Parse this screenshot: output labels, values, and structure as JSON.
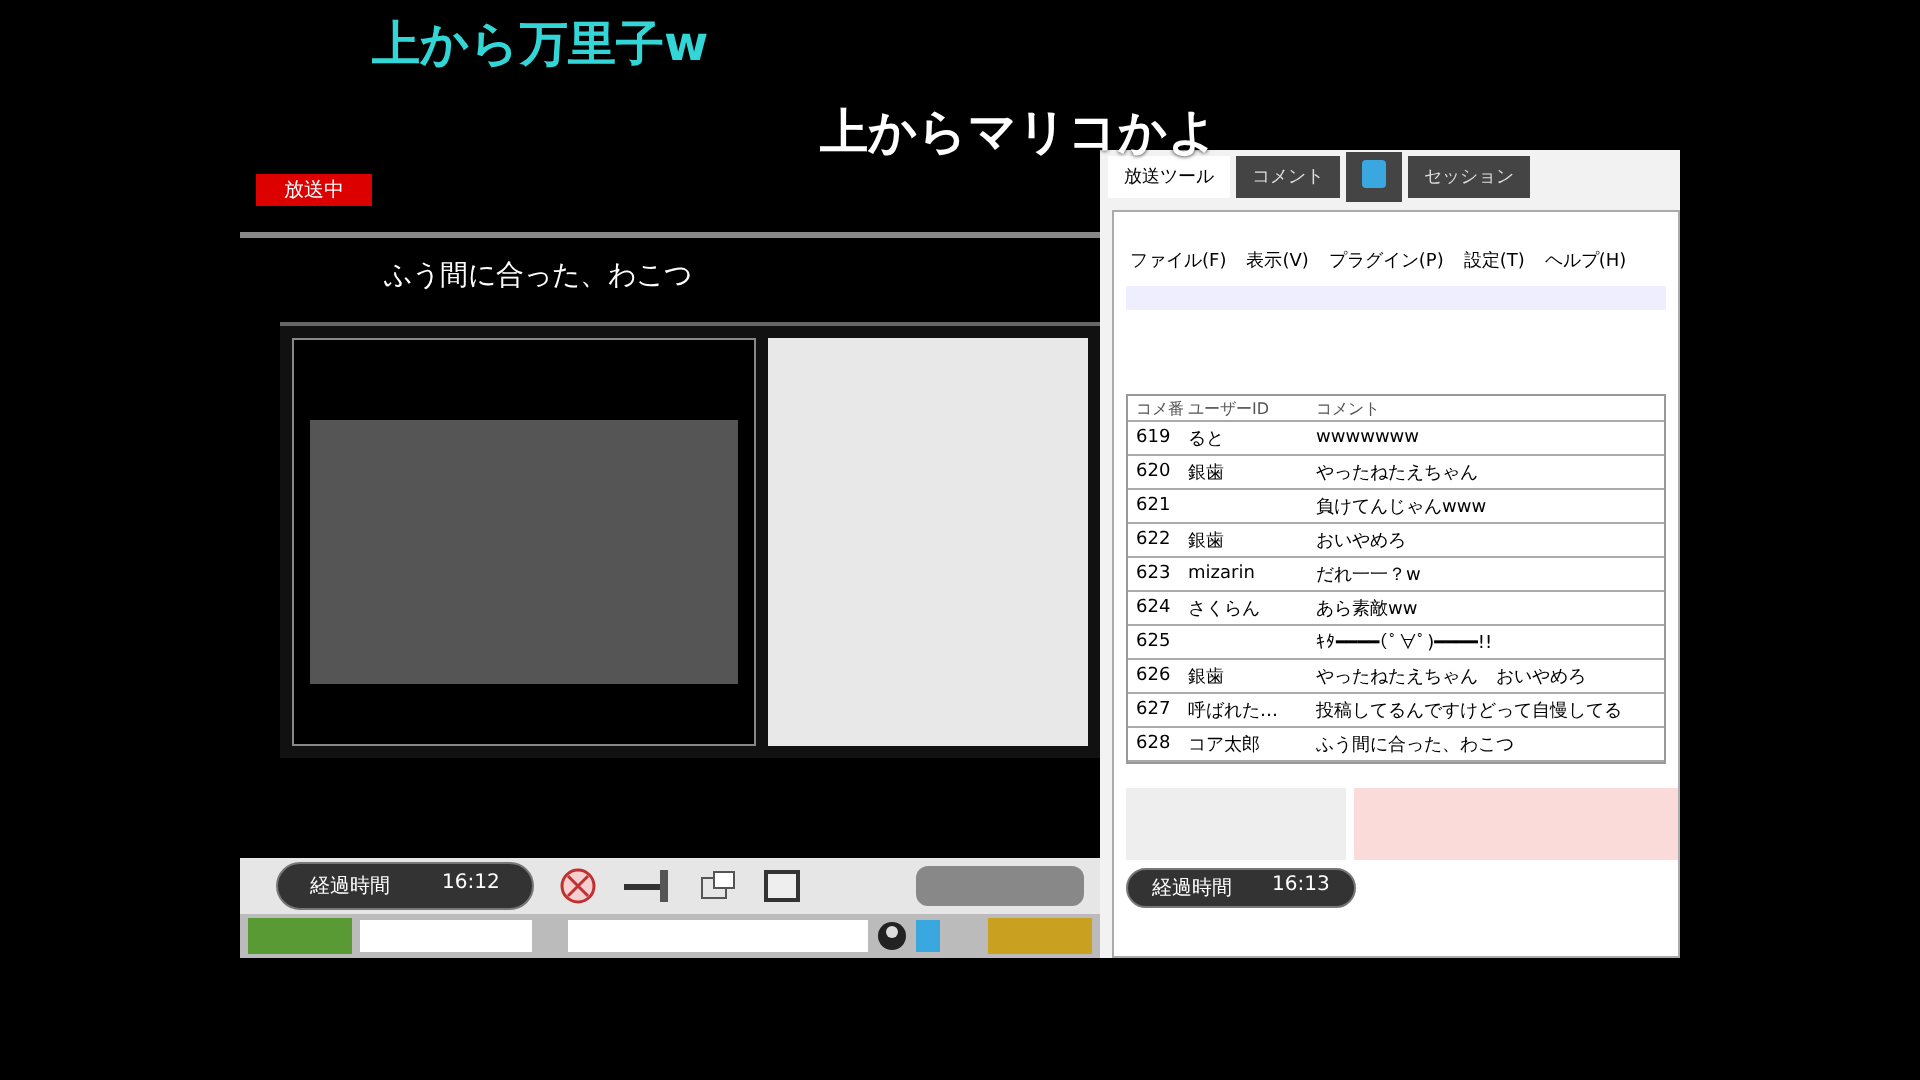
{
  "overlay_comments": [
    {
      "text": "上から万里子w",
      "color": "#33d6d6"
    },
    {
      "text": "上からマリコかよ",
      "color": "#ffffff"
    }
  ],
  "player": {
    "status_label": "放送中",
    "caption": "ふう間に合った、わこつ",
    "elapsed_label": "経過時間",
    "elapsed": "16:12"
  },
  "tool": {
    "tabs": [
      {
        "label": "放送ツール",
        "selected": true
      },
      {
        "label": "コメント",
        "selected": false
      },
      {
        "kind": "twitter",
        "selected": false
      },
      {
        "label": "セッション",
        "selected": false
      }
    ],
    "menu": [
      "ファイル(F)",
      "表示(V)",
      "プラグイン(P)",
      "設定(T)",
      "ヘルプ(H)"
    ],
    "columns": [
      "コメ番",
      "ユーザーID",
      "コメント"
    ],
    "rows": [
      {
        "no": "619",
        "user": "ると",
        "comment": "wwwwwww"
      },
      {
        "no": "620",
        "user": "銀歯",
        "comment": "やったねたえちゃん"
      },
      {
        "no": "621",
        "comment": "負けてんじゃんwww"
      },
      {
        "no": "622",
        "user": "銀歯",
        "comment": "おいやめろ"
      },
      {
        "no": "623",
        "user": "mizarin",
        "comment": "だれ一一？w"
      },
      {
        "no": "624",
        "user": "さくらん",
        "comment": "あら素敵ww"
      },
      {
        "no": "625",
        "comment": "ｷﾀ━━━━(ﾟ∀ﾟ)━━━━!!"
      },
      {
        "no": "626",
        "user": "銀歯",
        "comment": "やったねたえちゃん　おいやめろ"
      },
      {
        "no": "627",
        "user": "呼ばれた…",
        "comment": "投稿してるんですけどって自慢してる"
      },
      {
        "no": "628",
        "user": "コア太郎",
        "comment": "ふう間に合った、わこつ"
      }
    ],
    "elapsed_label": "経過時間",
    "elapsed": "16:13"
  }
}
